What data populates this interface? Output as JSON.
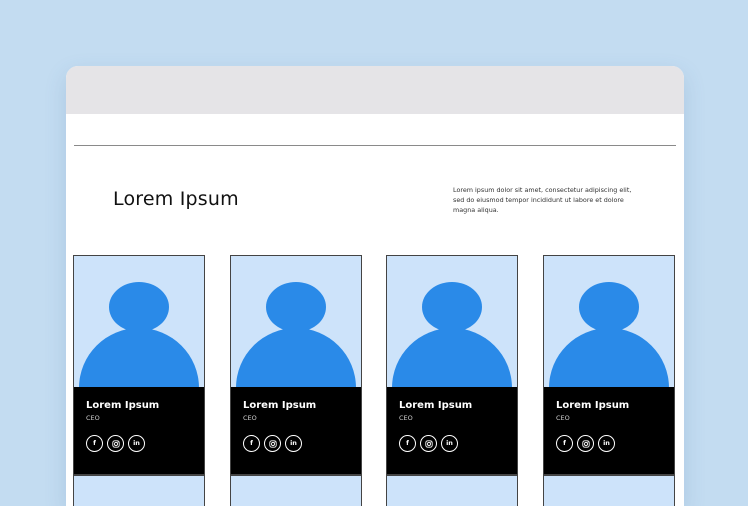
{
  "section": {
    "title": "Lorem Ipsum",
    "description": "Lorem ipsum dolor sit amet, consectetur adipiscing elit, sed do eiusmod tempor incididunt ut labore et dolore magna aliqua."
  },
  "team": [
    {
      "name": "Lorem Ipsum",
      "role": "CEO"
    },
    {
      "name": "Lorem Ipsum",
      "role": "CEO"
    },
    {
      "name": "Lorem Ipsum",
      "role": "CEO"
    },
    {
      "name": "Lorem Ipsum",
      "role": "CEO"
    }
  ],
  "social_icons": {
    "facebook": {
      "icon": "facebook-icon",
      "glyph": "f"
    },
    "instagram": {
      "icon": "instagram-icon"
    },
    "linkedin": {
      "icon": "linkedin-icon",
      "glyph": "in"
    }
  },
  "colors": {
    "page_background": "#c3dcf1",
    "titlebar": "#e5e4e7",
    "avatar": "#2a8ae8",
    "photo_background": "#cde3fa",
    "card_footer": "#000000"
  }
}
